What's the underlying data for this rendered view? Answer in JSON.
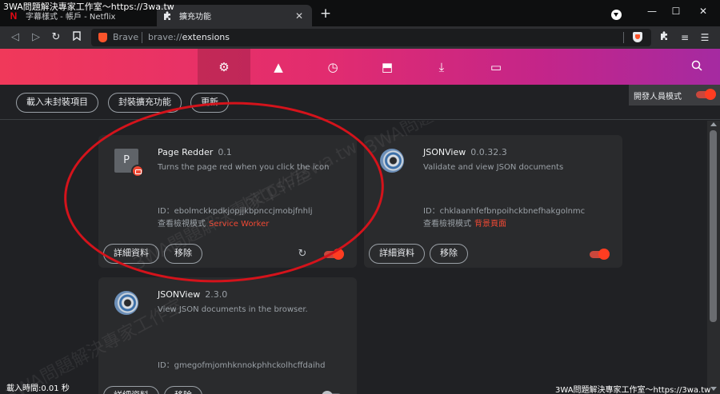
{
  "overlay": {
    "top_title": "3WA問題解決專家工作室～https://3wa.tw",
    "diag_watermark_1": "3WA問題解決專家工作室",
    "diag_watermark_2": "https://3wa.tw",
    "bottom_watermark": "3WA問題解決專家工作室～https://3wa.tw",
    "load_time": "載入時間:0.01 秒"
  },
  "tabs": [
    {
      "label": "字幕樣式 - 帳戶 - Netflix",
      "icon": "netflix-icon",
      "active": false
    },
    {
      "label": "擴充功能",
      "icon": "puzzle-icon",
      "active": true
    }
  ],
  "window": {
    "minimize": "—",
    "maximize": "☐",
    "close": "✕"
  },
  "address_bar": {
    "brand": "Brave",
    "url_prefix": "brave://",
    "url_host": "extensions"
  },
  "header_nav": [
    {
      "name": "settings-icon",
      "glyph": "⚙",
      "active": true
    },
    {
      "name": "rewards-icon",
      "glyph": "▲",
      "active": false
    },
    {
      "name": "history-icon",
      "glyph": "◷",
      "active": false
    },
    {
      "name": "bookmarks-icon",
      "glyph": "⬒",
      "active": false
    },
    {
      "name": "downloads-icon",
      "glyph": "⤓",
      "active": false
    },
    {
      "name": "wallet-icon",
      "glyph": "▭",
      "active": false
    }
  ],
  "actions": {
    "load_unpacked": "載入未封裝項目",
    "pack_extension": "封裝擴充功能",
    "update": "更新",
    "developer_mode_label": "開發人員模式",
    "developer_mode_on": true
  },
  "extensions": [
    {
      "name": "Page Redder",
      "version": "0.1",
      "description": "Turns the page red when you click the icon",
      "id": "ID：ebolmckkpdkjopjjkbpnccjmobjfnhlj",
      "inspect_label": "查看檢視模式",
      "inspect_link": "Service Worker",
      "details": "詳細資料",
      "remove": "移除",
      "enabled": true,
      "icon_letter": "P"
    },
    {
      "name": "JSONView",
      "version": "0.0.32.3",
      "description": "Validate and view JSON documents",
      "id": "ID：chklaanhfefbnpoihckbnefhakgolnmc",
      "inspect_label": "查看檢視模式",
      "inspect_link": "背景頁面",
      "details": "詳細資料",
      "remove": "移除",
      "enabled": true
    },
    {
      "name": "JSONView",
      "version": "2.3.0",
      "description": "View JSON documents in the browser.",
      "id": "ID：gmegofmjomhknnokphhckolhcffdaihd",
      "details": "詳細資料",
      "remove": "移除",
      "enabled": false
    }
  ],
  "colors": {
    "accent": "#f04934",
    "header_start": "#f0395a",
    "header_end": "#a52aa1",
    "annotation": "#d4131b"
  }
}
